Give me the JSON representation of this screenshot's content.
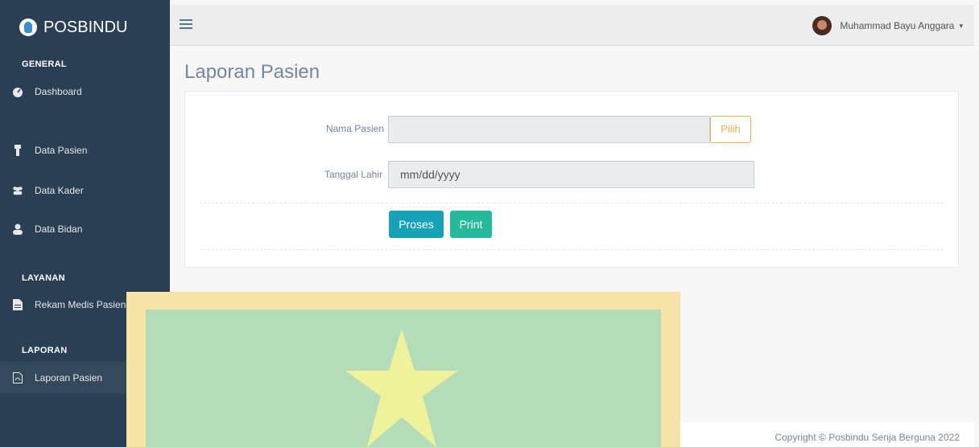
{
  "brand": {
    "name": "POSBINDU",
    "icon": "posbindu-logo-icon"
  },
  "sidebar": {
    "sections": [
      {
        "title": "GENERAL"
      },
      {
        "title": "LAYANAN"
      },
      {
        "title": "LAPORAN"
      }
    ],
    "items": [
      {
        "label": "Dashboard",
        "icon": "dashboard-icon"
      },
      {
        "label": "Data Pasien",
        "icon": "user-icon"
      },
      {
        "label": "Data Kader",
        "icon": "users-icon"
      },
      {
        "label": "Data Bidan",
        "icon": "user-icon"
      },
      {
        "label": "Rekam Medis Pasien",
        "icon": "file-icon"
      },
      {
        "label": "Laporan Pasien",
        "icon": "pdf-file-icon",
        "active": true
      }
    ],
    "active_color": "#1abb9c"
  },
  "topbar": {
    "menu_icon": "hamburger-icon",
    "user_name": "Muhammad Bayu Anggara",
    "caret": "▾"
  },
  "main": {
    "title": "Laporan Pasien",
    "form": {
      "nama_label": "Nama Pasien",
      "nama_value": "",
      "pilih_label": "Pilih",
      "tanggal_label": "Tanggal Lahir",
      "tanggal_placeholder": "mm/dd/yyyy",
      "proses_label": "Proses",
      "print_label": "Print"
    }
  },
  "footer": {
    "copyright": "Copyright © Posbindu Senja Berguna 2022"
  },
  "colors": {
    "sidebar_bg": "#2a3f54",
    "btn_proses": "#17a2b8",
    "btn_print": "#26b99a",
    "btn_pilih": "#f0ad4e"
  }
}
